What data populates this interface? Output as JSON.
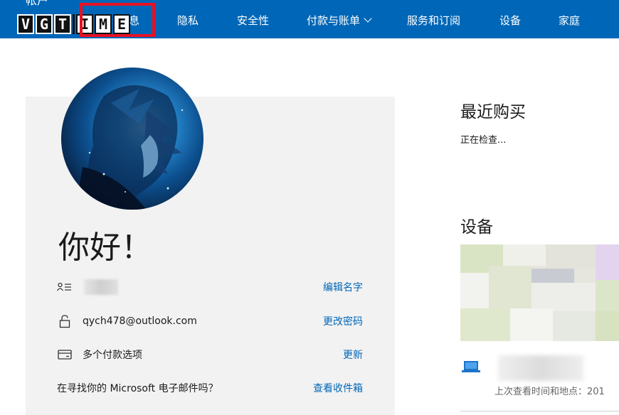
{
  "nav": {
    "cut_label": "帐户",
    "items": [
      {
        "label": "信息",
        "visible_text": "息"
      },
      {
        "label": "隐私"
      },
      {
        "label": "安全性"
      },
      {
        "label": "付款与账单"
      },
      {
        "label": "服务和订阅"
      },
      {
        "label": "设备"
      },
      {
        "label": "家庭"
      }
    ]
  },
  "watermark": {
    "letters": [
      "V",
      "G",
      "T",
      "I",
      "M",
      "E"
    ]
  },
  "profile": {
    "greeting": "你好！",
    "rows": [
      {
        "icon": "person-list-icon",
        "value": "",
        "action": "编辑名字"
      },
      {
        "icon": "lock-icon",
        "value": "qych478@outlook.com",
        "action": "更改密码"
      },
      {
        "icon": "card-icon",
        "value": "多个付款选项",
        "action": "更新"
      },
      {
        "icon": "",
        "value": "在寻找你的 Microsoft 电子邮件吗？",
        "action": "查看收件箱"
      }
    ]
  },
  "recent": {
    "title": "最近购买",
    "status": "正在检查..."
  },
  "devices": {
    "title": "设备",
    "last_seen": "上次查看时间和地点：201"
  },
  "colors": {
    "nav_bg": "#0067b8",
    "link": "#0067b8",
    "card_bg": "#f2f2f2",
    "highlight": "#e81123"
  }
}
